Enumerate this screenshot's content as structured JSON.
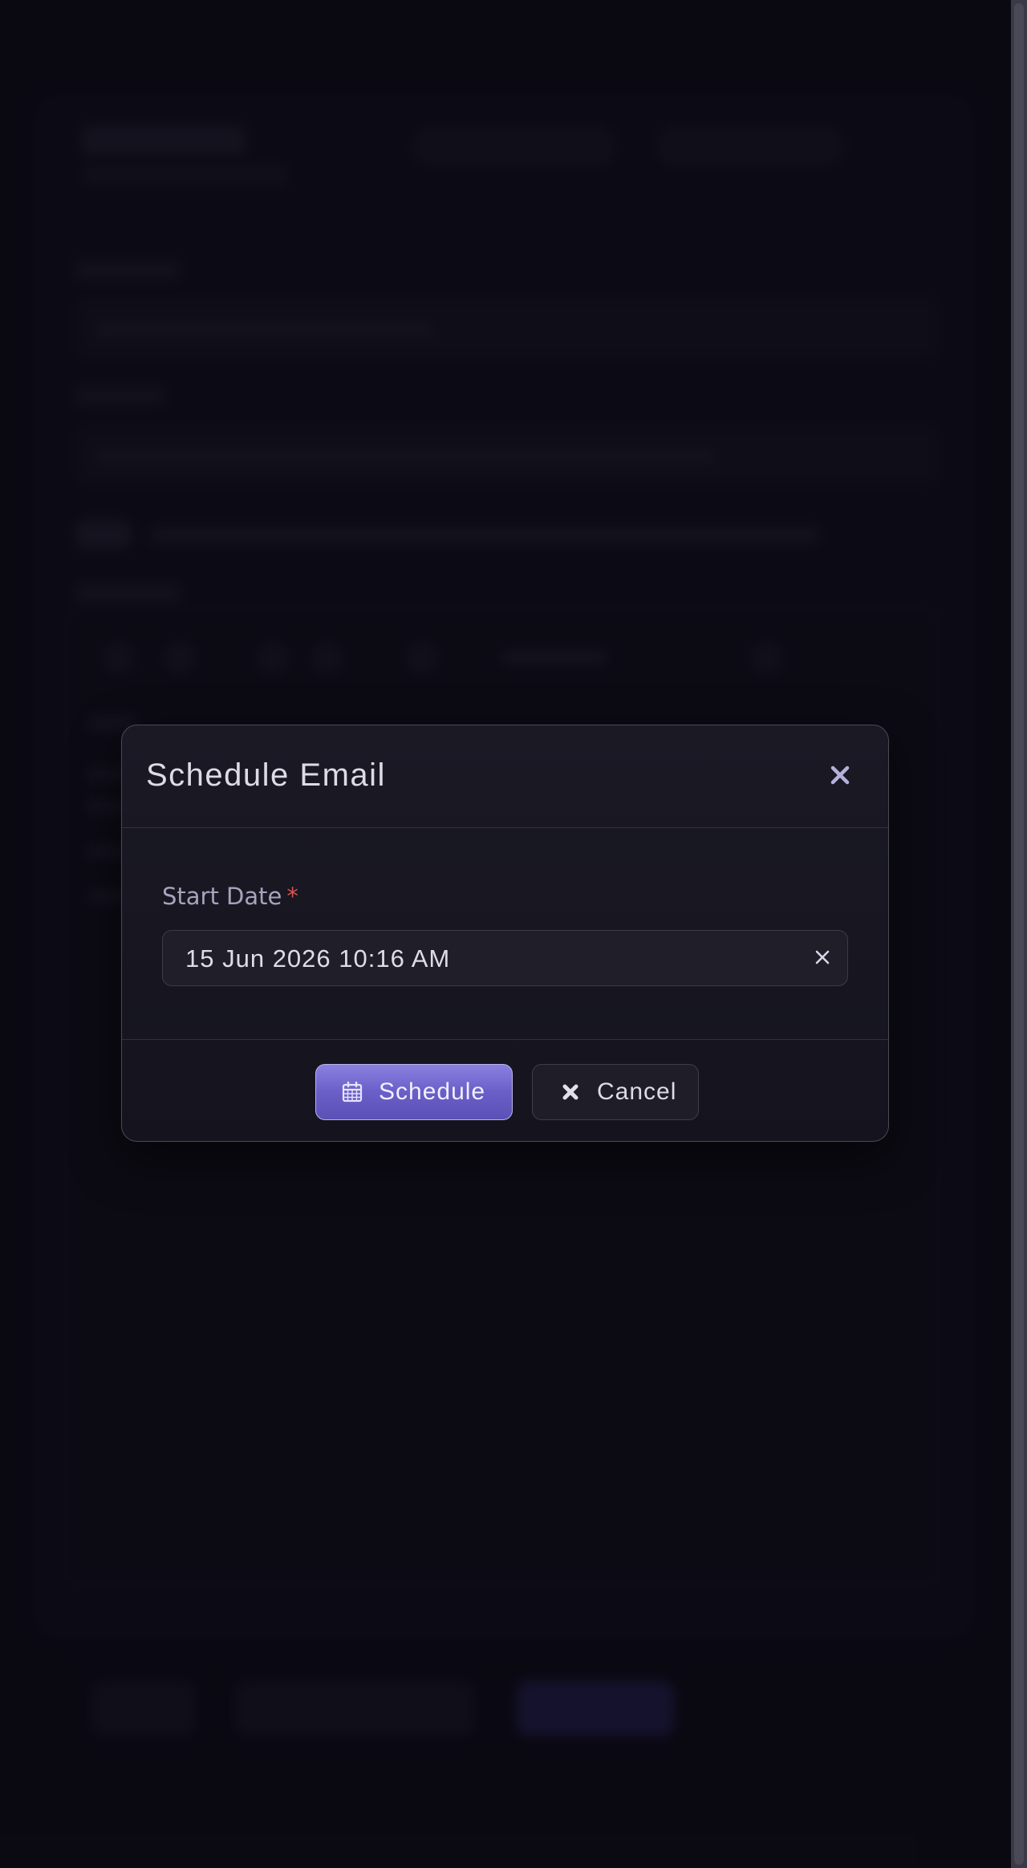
{
  "modal": {
    "title": "Schedule Email",
    "close_icon": "close-icon",
    "field": {
      "label": "Start Date",
      "required_marker": "*",
      "value": "15 Jun 2026 10:16 AM",
      "clear_icon": "clear-icon"
    },
    "buttons": {
      "schedule_label": "Schedule",
      "schedule_icon": "calendar-icon",
      "cancel_label": "Cancel",
      "cancel_icon": "cross-icon"
    }
  },
  "colors": {
    "accent": "#6a5fc8",
    "required": "#d9534f",
    "background": "#0c0b15",
    "modal_bg": "#1a1924"
  }
}
